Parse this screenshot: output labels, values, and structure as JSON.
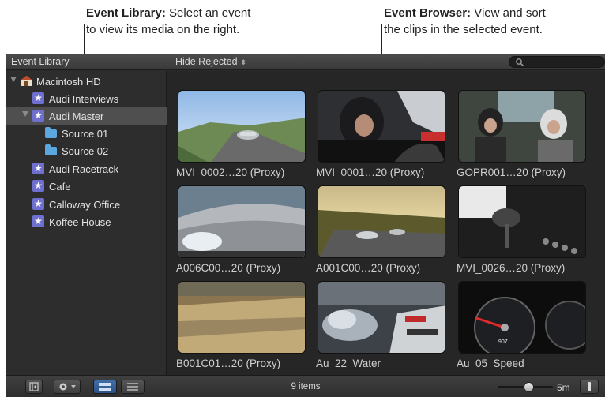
{
  "annotations": {
    "left": {
      "title": "Event Library:",
      "text1": " Select an event",
      "text2": "to view its media on the right."
    },
    "right": {
      "title": "Event Browser:",
      "text1": " View and sort",
      "text2": "the clips in the selected event."
    }
  },
  "toolbar": {
    "library_title": "Event Library",
    "filter": "Hide Rejected",
    "search_placeholder": ""
  },
  "sidebar": {
    "items": [
      {
        "label": "Macintosh HD",
        "icon": "drive-icon"
      },
      {
        "label": "Audi Interviews",
        "icon": "event-star-icon"
      },
      {
        "label": "Audi Master",
        "icon": "event-star-icon",
        "selected": true
      },
      {
        "label": "Source 01",
        "icon": "folder-icon"
      },
      {
        "label": "Source 02",
        "icon": "folder-icon"
      },
      {
        "label": "Audi Racetrack",
        "icon": "event-star-icon"
      },
      {
        "label": "Cafe",
        "icon": "event-star-icon"
      },
      {
        "label": "Calloway Office",
        "icon": "event-star-icon"
      },
      {
        "label": "Koffee House",
        "icon": "event-star-icon"
      }
    ]
  },
  "browser": {
    "clips": [
      {
        "name": "MVI_0002…20 (Proxy)"
      },
      {
        "name": "MVI_0001…20 (Proxy)"
      },
      {
        "name": "GOPR001…20 (Proxy)"
      },
      {
        "name": "A006C00…20 (Proxy)"
      },
      {
        "name": "A001C00…20 (Proxy)"
      },
      {
        "name": "MVI_0026…20 (Proxy)"
      },
      {
        "name": "B001C01…20 (Proxy)"
      },
      {
        "name": "Au_22_Water"
      },
      {
        "name": "Au_05_Speed"
      }
    ]
  },
  "bottombar": {
    "items_count": "9 items",
    "zoom": "5m"
  },
  "colors": {
    "selection": "#4f4f4f",
    "event_icon": "#6f6fd0",
    "folder_icon": "#5ba7e0",
    "active_button": "#2b5286"
  }
}
